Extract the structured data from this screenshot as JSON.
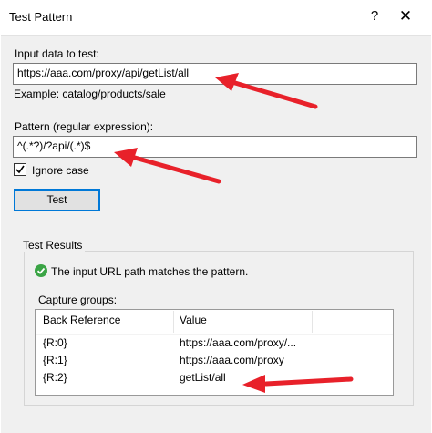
{
  "window": {
    "title": "Test Pattern",
    "help_label": "?",
    "close_label": "✕"
  },
  "input_section": {
    "label": "Input data to test:",
    "value": "https://aaa.com/proxy/api/getList/all",
    "example": "Example: catalog/products/sale"
  },
  "pattern_section": {
    "label": "Pattern (regular expression):",
    "value": "^(.*?)/?api/(.*)$"
  },
  "ignore_case": {
    "label": "Ignore case",
    "checked": true
  },
  "test_button": {
    "label": "Test"
  },
  "results": {
    "group_title": "Test Results",
    "status_message": "The input URL path matches the pattern.",
    "capture_label": "Capture groups:",
    "columns": [
      "Back Reference",
      "Value"
    ],
    "rows": [
      {
        "ref": "{R:0}",
        "value": "https://aaa.com/proxy/..."
      },
      {
        "ref": "{R:1}",
        "value": "https://aaa.com/proxy"
      },
      {
        "ref": "{R:2}",
        "value": "getList/all"
      }
    ]
  },
  "colors": {
    "accent": "#0078d7",
    "annotation_arrow": "#e8212a",
    "success": "#3aa445",
    "dialog_bg": "#f0f0f0"
  }
}
